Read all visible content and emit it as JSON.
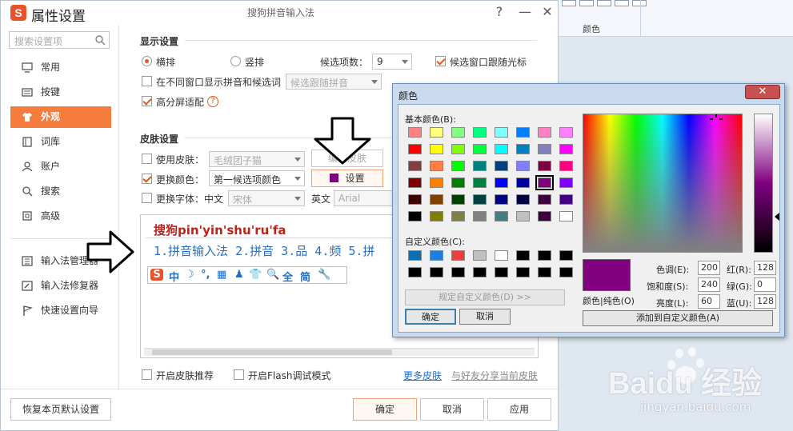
{
  "background": {
    "ribbon_label": "颜色",
    "watermark": {
      "logo": "Baidu 经验",
      "url": "jingyan.baidu.com"
    }
  },
  "window": {
    "title": "属性设置",
    "caption": "搜狗拼音输入法",
    "controls": {
      "help": "?",
      "minimize": "—",
      "close": "✕"
    }
  },
  "sidebar": {
    "search_placeholder": "搜索设置项",
    "items": [
      {
        "label": "常用",
        "icon": "monitor-icon"
      },
      {
        "label": "按键",
        "icon": "keyboard-icon"
      },
      {
        "label": "外观",
        "icon": "shirt-icon",
        "active": true
      },
      {
        "label": "词库",
        "icon": "book-icon"
      },
      {
        "label": "账户",
        "icon": "user-icon"
      },
      {
        "label": "搜索",
        "icon": "search-icon"
      },
      {
        "label": "高级",
        "icon": "square-icon"
      }
    ],
    "tools": [
      {
        "label": "输入法管理器",
        "icon": "manager-icon"
      },
      {
        "label": "输入法修复器",
        "icon": "repair-icon"
      },
      {
        "label": "快速设置向导",
        "icon": "flag-icon"
      }
    ]
  },
  "display": {
    "section_title": "显示设置",
    "horizontal": "横排",
    "vertical": "竖排",
    "candidate_count_label": "候选项数：",
    "candidate_count": "9",
    "follow_cursor": "候选窗口跟随光标",
    "show_in_other": "在不同窗口显示拼音和候选词",
    "show_in_other_select": "候选跟随拼音",
    "hidpi": "高分屏适配",
    "help": "?"
  },
  "skin": {
    "section_title": "皮肤设置",
    "use_skin": "使用皮肤：",
    "skin_select": "毛绒团子猫",
    "edit_skin": "编辑皮肤",
    "change_color": "更换颜色：",
    "color_select": "第一候选项颜色",
    "set_button": "设置",
    "set_color": "#800080",
    "change_font": "更换字体：中文",
    "font_cn": "宋体",
    "font_en_label": "英文",
    "font_en": "Arial"
  },
  "preview": {
    "composition": "搜狗pin'yin'shu'ru'fa",
    "candidates": "1.拼音输入法  2.拼音  3.品  4.频  5.拼",
    "toolbar": [
      "S",
      "中",
      "☽",
      "°,",
      "▦",
      "♟",
      "👕",
      "🔍",
      "全",
      "简",
      "🔧"
    ]
  },
  "bottom_options": {
    "skin_recommend": "开启皮肤推荐",
    "flash_debug": "开启Flash调试模式",
    "more_skins": "更多皮肤",
    "share_skin": "与好友分享当前皮肤"
  },
  "footer": {
    "restore": "恢复本页默认设置",
    "ok": "确定",
    "cancel": "取消",
    "apply": "应用"
  },
  "color_dialog": {
    "title": "颜色",
    "close": "✕",
    "basic_label": "基本颜色(B):",
    "basic_colors": [
      "#ff8080",
      "#ffff80",
      "#80ff80",
      "#00ff80",
      "#80ffff",
      "#0080ff",
      "#ff80c0",
      "#ff80ff",
      "#ff0000",
      "#ffff00",
      "#80ff00",
      "#00ff40",
      "#00ffff",
      "#0080c0",
      "#8080c0",
      "#ff00ff",
      "#804040",
      "#ff8040",
      "#00ff00",
      "#008080",
      "#004080",
      "#8080ff",
      "#800040",
      "#ff0080",
      "#800000",
      "#ff8000",
      "#008000",
      "#008040",
      "#0000ff",
      "#0000a0",
      "#800080",
      "#8000ff",
      "#400000",
      "#804000",
      "#004000",
      "#004040",
      "#000080",
      "#000040",
      "#400040",
      "#400080",
      "#000000",
      "#808000",
      "#808040",
      "#808080",
      "#408080",
      "#c0c0c0",
      "#400040",
      "#ffffff"
    ],
    "selected_index": 30,
    "custom_label": "自定义颜色(C):",
    "custom_colors": [
      "#0b6fb6",
      "#1e7fd8",
      "#e84040",
      "#c0c0c0",
      "#ffffff",
      "#000000",
      "#000000",
      "#000000",
      "#000000",
      "#000000",
      "#000000",
      "#000000",
      "#000000",
      "#000000",
      "#000000",
      "#000000"
    ],
    "define_custom": "规定自定义颜色(D) >>",
    "ok": "确定",
    "cancel": "取消",
    "color_solid": "颜色|纯色(O)",
    "hue_label": "色调(E):",
    "hue": "200",
    "sat_label": "饱和度(S):",
    "sat": "240",
    "lum_label": "亮度(L):",
    "lum": "60",
    "red_label": "红(R):",
    "red": "128",
    "green_label": "绿(G):",
    "green": "0",
    "blue_label": "蓝(U):",
    "blue": "128",
    "add_custom": "添加到自定义颜色(A)",
    "preview_color": "#800080"
  }
}
